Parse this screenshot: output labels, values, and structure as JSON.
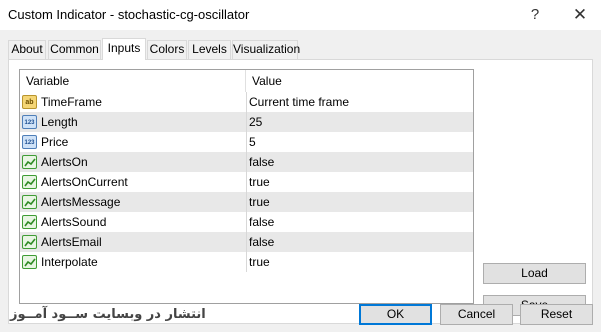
{
  "window": {
    "title": "Custom Indicator - stochastic-cg-oscillator",
    "help_label": "?",
    "close_label": "✕"
  },
  "tabs": [
    {
      "label": "About",
      "active": false
    },
    {
      "label": "Common",
      "active": false
    },
    {
      "label": "Inputs",
      "active": true
    },
    {
      "label": "Colors",
      "active": false
    },
    {
      "label": "Levels",
      "active": false
    },
    {
      "label": "Visualization",
      "active": false
    }
  ],
  "grid": {
    "columns": [
      "Variable",
      "Value"
    ],
    "rows": [
      {
        "icon": "string-icon",
        "icon_text": "ab",
        "name": "TimeFrame",
        "value": "Current time frame"
      },
      {
        "icon": "number-icon",
        "icon_text": "123",
        "name": "Length",
        "value": "25"
      },
      {
        "icon": "number-icon",
        "icon_text": "123",
        "name": "Price",
        "value": "5"
      },
      {
        "icon": "boolean-icon",
        "icon_text": "",
        "name": "AlertsOn",
        "value": "false"
      },
      {
        "icon": "boolean-icon",
        "icon_text": "",
        "name": "AlertsOnCurrent",
        "value": "true"
      },
      {
        "icon": "boolean-icon",
        "icon_text": "",
        "name": "AlertsMessage",
        "value": "true"
      },
      {
        "icon": "boolean-icon",
        "icon_text": "",
        "name": "AlertsSound",
        "value": "false"
      },
      {
        "icon": "boolean-icon",
        "icon_text": "",
        "name": "AlertsEmail",
        "value": "false"
      },
      {
        "icon": "boolean-icon",
        "icon_text": "",
        "name": "Interpolate",
        "value": "true"
      }
    ]
  },
  "side_buttons": {
    "load": "Load",
    "save": "Save"
  },
  "footer_buttons": {
    "ok": "OK",
    "cancel": "Cancel",
    "reset": "Reset"
  },
  "watermark": "انتشار در وبسایت ســود آمــوز",
  "colors": {
    "accent": "#0078d7",
    "row_shade": "#e8e8e8",
    "panel": "#f0f0f0"
  }
}
